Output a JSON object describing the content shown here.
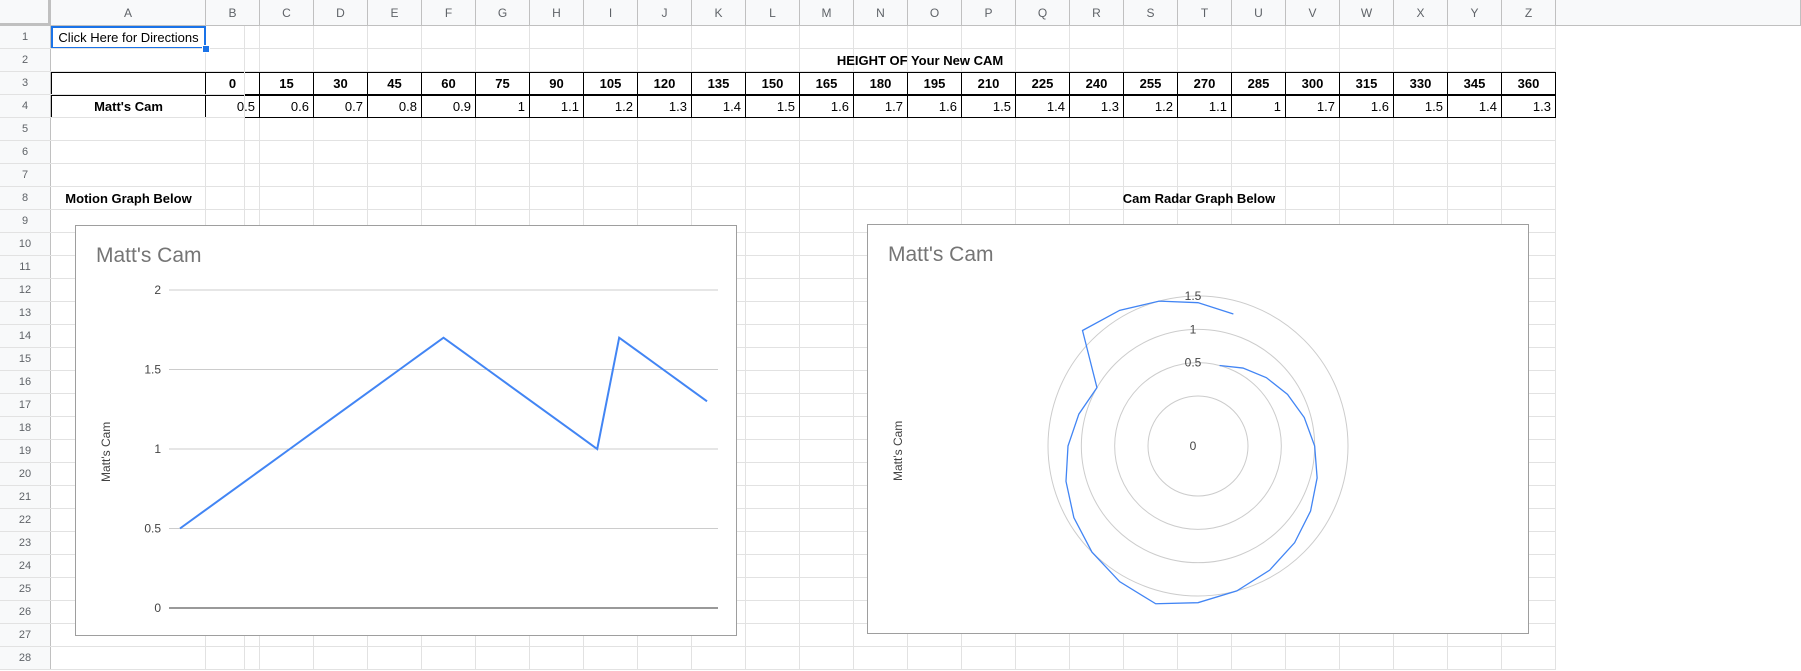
{
  "columns": [
    "A",
    "B",
    "C",
    "D",
    "E",
    "F",
    "G",
    "H",
    "I",
    "J",
    "K",
    "L",
    "M",
    "N",
    "O",
    "P",
    "Q",
    "R",
    "S",
    "T",
    "U",
    "V",
    "W",
    "X",
    "Y",
    "Z"
  ],
  "rows": [
    "1",
    "2",
    "3",
    "4",
    "5",
    "6",
    "7",
    "8",
    "9",
    "10",
    "11",
    "12",
    "13",
    "14",
    "15",
    "16",
    "17",
    "18",
    "19",
    "20",
    "21",
    "22",
    "23",
    "24",
    "25",
    "26",
    "27",
    "28"
  ],
  "cells": {
    "A1": "Click Here for Directions",
    "title": "HEIGHT OF Your New CAM",
    "row_label": "Matt's Cam",
    "motion_label": "Motion Graph Below",
    "radar_label": "Cam Radar Graph Below"
  },
  "angles": [
    "0",
    "15",
    "30",
    "45",
    "60",
    "75",
    "90",
    "105",
    "120",
    "135",
    "150",
    "165",
    "180",
    "195",
    "210",
    "225",
    "240",
    "255",
    "270",
    "285",
    "300",
    "315",
    "330",
    "345",
    "360"
  ],
  "heights": [
    "0.5",
    "0.6",
    "0.7",
    "0.8",
    "0.9",
    "1",
    "1.1",
    "1.2",
    "1.3",
    "1.4",
    "1.5",
    "1.6",
    "1.7",
    "1.6",
    "1.5",
    "1.4",
    "1.3",
    "1.2",
    "1.1",
    "1",
    "1.7",
    "1.6",
    "1.5",
    "1.4",
    "1.3"
  ],
  "chart_data": [
    {
      "type": "line",
      "title": "Matt's Cam",
      "ylabel": "Matt's Cam",
      "xlabel": "",
      "x": [
        0,
        15,
        30,
        45,
        60,
        75,
        90,
        105,
        120,
        135,
        150,
        165,
        180,
        195,
        210,
        225,
        240,
        255,
        270,
        285,
        300,
        315,
        330,
        345,
        360
      ],
      "series": [
        {
          "values": [
            0.5,
            0.6,
            0.7,
            0.8,
            0.9,
            1,
            1.1,
            1.2,
            1.3,
            1.4,
            1.5,
            1.6,
            1.7,
            1.6,
            1.5,
            1.4,
            1.3,
            1.2,
            1.1,
            1,
            1.7,
            1.6,
            1.5,
            1.4,
            1.3
          ]
        }
      ],
      "ylim": [
        0,
        2
      ],
      "yticks": [
        "0",
        "0.5",
        "1",
        "1.5",
        "2"
      ],
      "grid": true,
      "color": "#4285f4"
    },
    {
      "type": "radar",
      "title": "Matt's Cam",
      "ylabel": "Matt's Cam",
      "theta": [
        0,
        15,
        30,
        45,
        60,
        75,
        90,
        105,
        120,
        135,
        150,
        165,
        180,
        195,
        210,
        225,
        240,
        255,
        270,
        285,
        300,
        315,
        330,
        345,
        360
      ],
      "series": [
        {
          "values": [
            0.5,
            0.6,
            0.7,
            0.8,
            0.9,
            1,
            1.1,
            1.2,
            1.3,
            1.4,
            1.5,
            1.6,
            1.7,
            1.6,
            1.5,
            1.4,
            1.3,
            1.2,
            1.1,
            1,
            1.7,
            1.6,
            1.5,
            1.4,
            1.3
          ]
        }
      ],
      "rlim": [
        0,
        1.5
      ],
      "rticks": [
        "0",
        "0.5",
        "1",
        "1.5"
      ],
      "grid": true,
      "color": "#4285f4"
    }
  ]
}
